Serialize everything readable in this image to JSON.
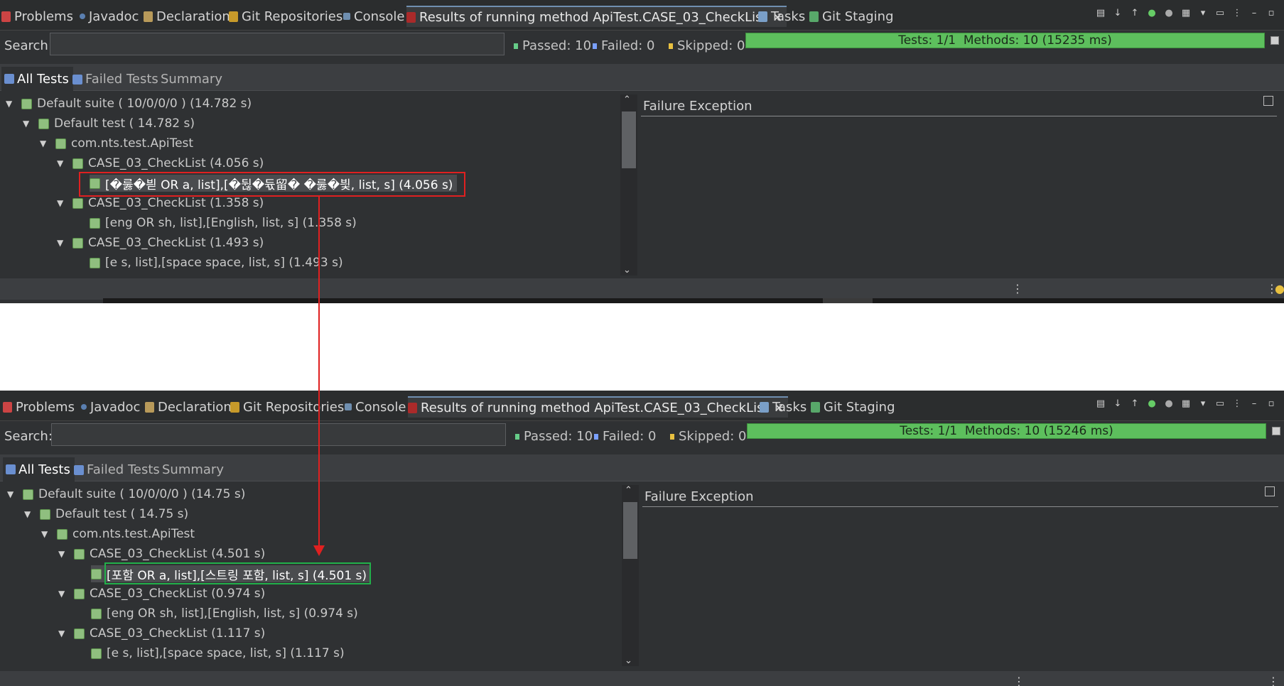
{
  "tabs": [
    {
      "label": "Problems",
      "icon": "problems-icon"
    },
    {
      "label": "Javadoc",
      "icon": "javadoc-icon"
    },
    {
      "label": "Declaration",
      "icon": "declaration-icon"
    },
    {
      "label": "Git Repositories",
      "icon": "git-repositories-icon"
    },
    {
      "label": "Console",
      "icon": "console-icon"
    },
    {
      "label": "Results of running method ApiTest.CASE_03_CheckList",
      "icon": "testng-icon",
      "active": true
    },
    {
      "label": "Tasks",
      "icon": "tasks-icon"
    },
    {
      "label": "Git Staging",
      "icon": "git-staging-icon"
    }
  ],
  "close_glyph": "✕",
  "search": {
    "label": "Search:",
    "value": ""
  },
  "stats": {
    "passed": "Passed: 10",
    "failed": "Failed: 0",
    "skipped": "Skipped: 0"
  },
  "subtabs": {
    "all_tests": "All Tests",
    "failed_tests": "Failed Tests",
    "summary": "Summary"
  },
  "failure_title": "Failure Exception",
  "top": {
    "progress": "Tests: 1/1  Methods: 10 (15235 ms)",
    "progress_fraction": 1.0,
    "tree": [
      "Default suite ( 10/0/0/0 ) (14.782 s)",
      "Default test ( 14.782 s)",
      "com.nts.test.ApiTest",
      "CASE_03_CheckList  (4.056 s)",
      "[�룷�븯 OR a, list],[�뒪�듃留� �룷�븿, list, s]  (4.056 s)",
      "CASE_03_CheckList  (1.358 s)",
      "[eng OR sh, list],[English, list, s]  (1.358 s)",
      "CASE_03_CheckList  (1.493 s)",
      "[e s, list],[space space, list, s]  (1.493 s)"
    ]
  },
  "bottom": {
    "progress": "Tests: 1/1  Methods: 10 (15246 ms)",
    "progress_fraction": 1.0,
    "tree": [
      "Default suite ( 10/0/0/0 ) (14.75 s)",
      "Default test ( 14.75 s)",
      "com.nts.test.ApiTest",
      "CASE_03_CheckList  (4.501 s)",
      "[포함 OR a, list],[스트링 포함, list, s]  (4.501 s)",
      "CASE_03_CheckList  (0.974 s)",
      "[eng OR sh, list],[English, list, s]  (0.974 s)",
      "CASE_03_CheckList  (1.117 s)",
      "[e s, list],[space space, list, s]  (1.117 s)"
    ]
  },
  "colors": {
    "panel_bg": "#2f3133",
    "progress_green": "#5dbf5d",
    "highlight_red": "#e02020",
    "highlight_green": "#22b04a"
  }
}
